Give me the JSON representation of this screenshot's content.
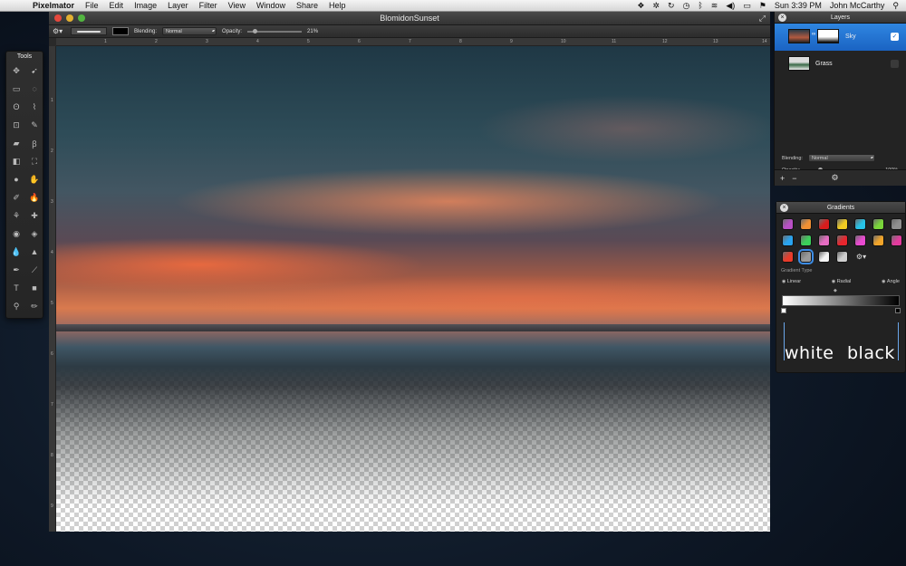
{
  "menubar": {
    "app_name": "Pixelmator",
    "items": [
      "File",
      "Edit",
      "Image",
      "Layer",
      "Filter",
      "View",
      "Window",
      "Share",
      "Help"
    ],
    "clock": "Sun 3:39 PM",
    "user": "John McCarthy"
  },
  "document": {
    "title": "BlomidonSunset",
    "ruler_top": [
      "1",
      "2",
      "3",
      "4",
      "5",
      "6",
      "7",
      "8",
      "9",
      "10",
      "11",
      "12",
      "13",
      "14"
    ],
    "ruler_left": [
      "1",
      "2",
      "3",
      "4",
      "5",
      "6",
      "7",
      "8",
      "9"
    ]
  },
  "toolbar": {
    "blending_label": "Blending:",
    "blending_value": "Normal",
    "opacity_label": "Opacity:",
    "opacity_value": "21%"
  },
  "tools": {
    "title": "Tools",
    "items": [
      "move-icon",
      "arrow-select-icon",
      "rect-marquee-icon",
      "ellipse-marquee-icon",
      "lasso-icon",
      "polygon-lasso-icon",
      "crop-icon",
      "eyedropper-icon",
      "eraser-icon",
      "brush-icon",
      "gradient-icon",
      "paint-bucket-icon",
      "sponge-icon",
      "smudge-icon",
      "paint-icon",
      "burn-icon",
      "stamp-icon",
      "heal-icon",
      "red-eye-icon",
      "magic-eraser-icon",
      "blur-icon",
      "sharpen-icon",
      "pen-icon",
      "freeform-pen-icon",
      "text-icon",
      "shape-icon",
      "zoom-icon",
      "color-picker-icon"
    ]
  },
  "layers": {
    "title": "Layers",
    "rows": [
      {
        "name": "Sky",
        "visible": true,
        "selected": true
      },
      {
        "name": "Grass",
        "visible": false,
        "selected": false
      }
    ],
    "blending_label": "Blending:",
    "blending_value": "Normal",
    "opacity_label": "Opacity:",
    "opacity_value": "100%",
    "footer": {
      "add": "+",
      "remove": "−",
      "gear": "⚙"
    }
  },
  "gradients": {
    "title": "Gradients",
    "swatch_colors": [
      "#b84fc5",
      "#f19033",
      "#d81c1c",
      "#f0cc22",
      "#27c3e8",
      "#7ad63a",
      "#8f8f8f",
      "#29a4f0",
      "#3bd05a",
      "#e66cc2",
      "#e8262e",
      "#e94ad0",
      "#f2a52a",
      "#e33b9e",
      "#e93b2a",
      "#9a9a9a",
      "#f4f4f4",
      "#cfcfcf"
    ],
    "selected_index": 15,
    "type_label": "Gradient Type",
    "types": [
      "Linear",
      "Radial",
      "Angle"
    ],
    "stop_left_label": "white",
    "stop_right_label": "black"
  },
  "colors": {
    "accent": "#1a63c3"
  }
}
